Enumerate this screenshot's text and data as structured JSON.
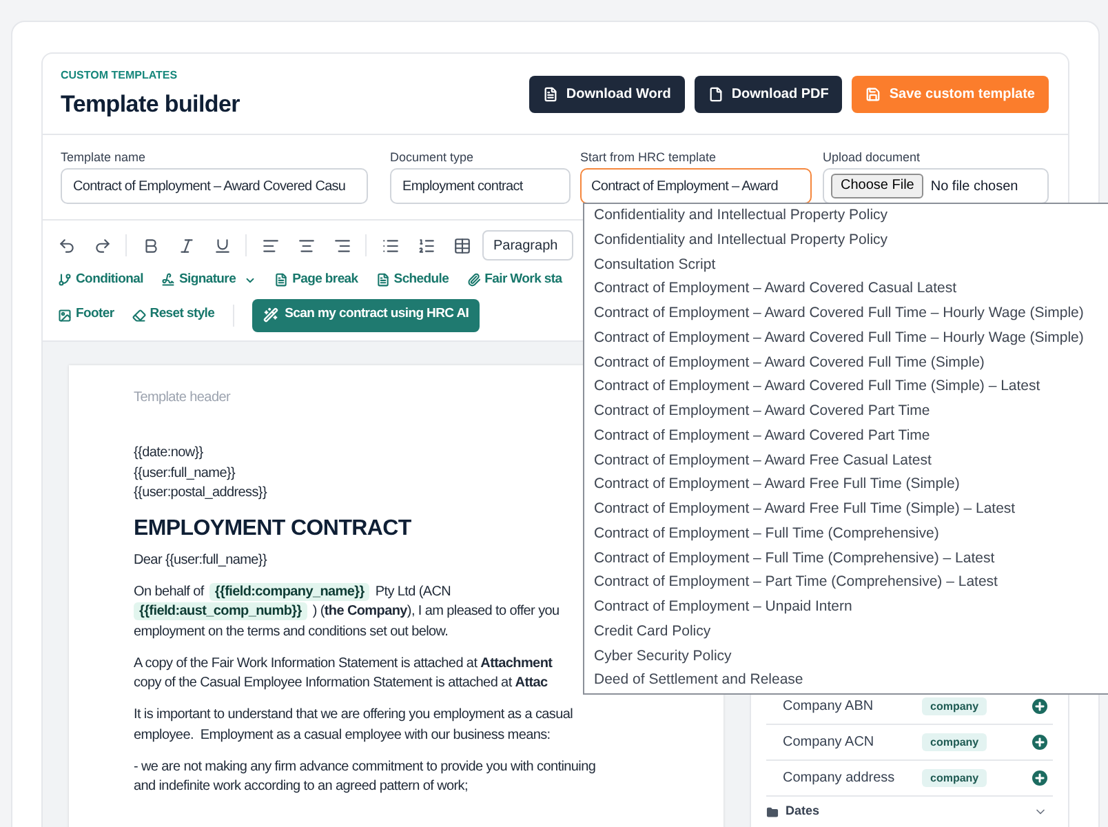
{
  "header": {
    "eyebrow": "CUSTOM TEMPLATES",
    "title": "Template builder",
    "actions": [
      {
        "label": "Download Word",
        "kind": "word"
      },
      {
        "label": "Download PDF",
        "kind": "pdf"
      },
      {
        "label": "Save custom template",
        "kind": "save"
      }
    ]
  },
  "fields": [
    {
      "kind": "text",
      "label": "Template name",
      "value": "Contract of Employment – Award Covered Casu"
    },
    {
      "kind": "text",
      "label": "Document type",
      "value": "Employment contract"
    },
    {
      "kind": "select",
      "label": "Start from HRC template",
      "value": "Contract of Employment – Award",
      "expanded": true,
      "options": [
        {
          "label": "Confidentiality and Intellectual Property Policy",
          "selected": false
        },
        {
          "label": "Confidentiality and Intellectual Property Policy",
          "selected": false
        },
        {
          "label": "Consultation Script",
          "selected": false
        },
        {
          "label": "Contract of Employment – Award Covered Casual Latest",
          "selected": false
        },
        {
          "label": "Contract of Employment – Award Covered Full Time – Hourly Wage (Simple)",
          "selected": false
        },
        {
          "label": "Contract of Employment – Award Covered Full Time – Hourly Wage (Simple)",
          "selected": false
        },
        {
          "label": "Contract of Employment – Award Covered Full Time (Simple)",
          "selected": false
        },
        {
          "label": "Contract of Employment – Award Covered Full Time (Simple) – Latest",
          "selected": false
        },
        {
          "label": "Contract of Employment – Award Covered Part Time",
          "selected": false
        },
        {
          "label": "Contract of Employment – Award Covered Part Time",
          "selected": false
        },
        {
          "label": "Contract of Employment – Award Free Casual Latest",
          "selected": false
        },
        {
          "label": "Contract of Employment – Award Free Full Time (Simple)",
          "selected": false
        },
        {
          "label": "Contract of Employment – Award Free Full Time (Simple) – Latest",
          "selected": false
        },
        {
          "label": "Contract of Employment – Full Time (Comprehensive)",
          "selected": false
        },
        {
          "label": "Contract of Employment – Full Time (Comprehensive) – Latest",
          "selected": false
        },
        {
          "label": "Contract of Employment – Part Time (Comprehensive) – Latest",
          "selected": false
        },
        {
          "label": "Contract of Employment – Unpaid Intern",
          "selected": false
        },
        {
          "label": "Credit Card Policy",
          "selected": false
        },
        {
          "label": "Cyber Security Policy",
          "selected": false
        },
        {
          "label": "Deed of Settlement and Release",
          "selected": false
        }
      ]
    },
    {
      "kind": "file",
      "label": "Upload document",
      "button": "Choose File",
      "status": "No file chosen"
    }
  ],
  "toolbar": {
    "paragraph_style": "Paragraph",
    "insert_rows": [
      [
        {
          "label": "Conditional",
          "kind": "conditional"
        },
        {
          "label": "Signature",
          "kind": "signature"
        },
        {
          "label": "Page break",
          "kind": "pagebreak"
        },
        {
          "label": "Schedule",
          "kind": "schedule"
        },
        {
          "label": "Fair Work sta",
          "kind": "attachment"
        }
      ],
      [
        {
          "label": "Footer",
          "kind": "footer"
        },
        {
          "label": "Reset style",
          "kind": "reset"
        },
        {
          "label": "Scan my contract using HRC AI",
          "kind": "ai"
        }
      ]
    ]
  },
  "document": {
    "template_header": {
      "placeholder": "Template header"
    },
    "merge_lines": [
      "{{date:now}}",
      "{{user:full_name}}",
      "{{user:postal_address}}"
    ],
    "title": "EMPLOYMENT CONTRACT",
    "greeting": "Dear {{user:full_name}}",
    "paragraphs": [
      {
        "lines": [
          [
            {
              "kind": "text",
              "text": "On behalf of"
            },
            {
              "kind": "field",
              "text": "{{field:company_name}}"
            },
            {
              "kind": "text",
              "text": "Pty Ltd (ACN"
            }
          ],
          [
            {
              "kind": "field",
              "text": "{{field:aust_comp_numb}}"
            },
            {
              "kind": "text",
              "text": ") (**the Company**), I am pleased to offer you"
            }
          ],
          [
            {
              "kind": "text",
              "text": "employment on the terms and conditions set out below."
            }
          ]
        ]
      },
      {
        "lines": [
          [
            {
              "kind": "text",
              "text": "A copy of the Fair Work Information Statement is attached at **Attachment**"
            }
          ],
          [
            {
              "kind": "text",
              "text": "copy of the Casual Employee Information Statement is attached at **Attac**"
            }
          ]
        ]
      },
      {
        "lines": [
          [
            {
              "kind": "text",
              "text": "It is important to understand that we are offering you employment as a casual"
            }
          ],
          [
            {
              "kind": "text",
              "text": "employee.  Employment as a casual employee with our business means:"
            }
          ]
        ]
      },
      {
        "lines": [
          [
            {
              "kind": "text",
              "text": "- we are not making any firm advance commitment to provide you with continuing"
            }
          ],
          [
            {
              "kind": "text",
              "text": "and indefinite work according to an agreed pattern of work;"
            }
          ]
        ]
      }
    ]
  },
  "sidebar": {
    "fields": [
      {
        "label": "Company ABN",
        "tag": "company"
      },
      {
        "label": "Company ACN",
        "tag": "company"
      },
      {
        "label": "Company address",
        "tag": "company"
      }
    ],
    "groups": [
      {
        "label": "Dates",
        "expanded": false
      }
    ]
  }
}
